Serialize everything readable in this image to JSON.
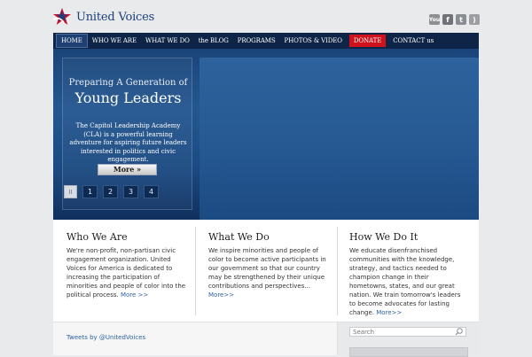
{
  "brand": {
    "name": "United Voices"
  },
  "social": {
    "icons": [
      "youtube-icon",
      "facebook-icon",
      "twitter-icon",
      "rss-icon"
    ],
    "glyphs": {
      "youtube": "You",
      "facebook": "f",
      "twitter": "t",
      "rss": ")"
    }
  },
  "nav": {
    "home": "HOME",
    "who": "WHO WE ARE",
    "what": "WHAT WE DO",
    "blog": "the BLOG",
    "programs": "PROGRAMS",
    "photos": "PHOTOS & VIDEO",
    "donate": "DONATE",
    "contact": "CONTACT us"
  },
  "hero": {
    "kicker": "Preparing A Generation of",
    "title": "Young Leaders",
    "description": "The Capitol Leadership Academy (CLA) is a powerful learning adventure for aspiring future leaders interested in politics and civic engagement.",
    "more_label": "More »",
    "pager": {
      "pause": "II",
      "pages": [
        "1",
        "2",
        "3",
        "4"
      ]
    }
  },
  "columns": {
    "who": {
      "title": "Who We Are",
      "text": "We're non-profit, non-partisan civic engagement organization. United Voices for America is dedicated to increasing the participation of minorities and people of color into the political process.",
      "link": "More >>"
    },
    "what": {
      "title": "What We Do",
      "text": "We inspire minorities and people of color to become active participants in our government so that our country may be strengthened by their unique contributions and perspectives...",
      "link": "More>>"
    },
    "how": {
      "title": "How We Do It",
      "text": "We educate disenfranchised communities with the knowledge, strategy, and tactics needed to champion change in their hometowns, states, and our great nation. We train tomorrow's leaders to become advocates for lasting change.",
      "link": "More>>"
    }
  },
  "footer": {
    "tweets_label": "Tweets by @UnitedVoices",
    "search_placeholder": "Search"
  },
  "colors": {
    "nav_bg": "#0e2547",
    "donate": "#d0121c",
    "link": "#2e62a4",
    "brand_text": "#1b3f7a"
  }
}
